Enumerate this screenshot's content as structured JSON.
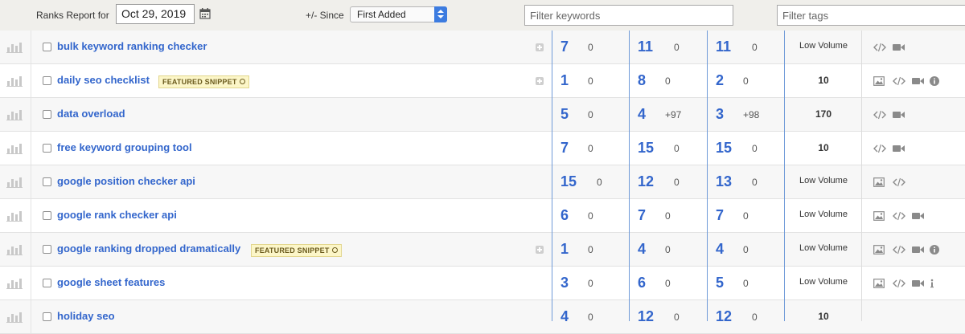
{
  "toolbar": {
    "report_label": "Ranks Report for",
    "date": "Oct 29, 2019",
    "since_label": "+/- Since",
    "since_selected": "First Added",
    "filter_keywords_placeholder": "Filter keywords",
    "filter_tags_placeholder": "Filter tags"
  },
  "colors": {
    "accent_blue": "#3366cc",
    "column_divider": "#6f9ad8",
    "featured_bg": "#fcf6c8"
  },
  "rows": [
    {
      "keyword": "bulk keyword ranking checker",
      "featured": "",
      "expand": true,
      "r1": "7",
      "c1": "0",
      "r2": "11",
      "c2": "0",
      "r3": "11",
      "c3": "0",
      "volume": "Low Volume",
      "icons": [
        "code-icon",
        "video-icon"
      ]
    },
    {
      "keyword": "daily seo checklist",
      "featured": "FEATURED SNIPPET",
      "expand": true,
      "r1": "1",
      "c1": "0",
      "r2": "8",
      "c2": "0",
      "r3": "2",
      "c3": "0",
      "volume": "10",
      "icons": [
        "image-icon",
        "code-icon",
        "video-icon",
        "info-icon"
      ]
    },
    {
      "keyword": "data overload",
      "featured": "",
      "expand": false,
      "r1": "5",
      "c1": "0",
      "r2": "4",
      "c2": "+97",
      "r3": "3",
      "c3": "+98",
      "volume": "170",
      "icons": [
        "code-icon",
        "video-icon"
      ]
    },
    {
      "keyword": "free keyword grouping tool",
      "featured": "",
      "expand": false,
      "r1": "7",
      "c1": "0",
      "r2": "15",
      "c2": "0",
      "r3": "15",
      "c3": "0",
      "volume": "10",
      "icons": [
        "code-icon",
        "video-icon"
      ]
    },
    {
      "keyword": "google position checker api",
      "featured": "",
      "expand": false,
      "r1": "15",
      "c1": "0",
      "r2": "12",
      "c2": "0",
      "r3": "13",
      "c3": "0",
      "volume": "Low Volume",
      "icons": [
        "image-icon",
        "code-icon"
      ]
    },
    {
      "keyword": "google rank checker api",
      "featured": "",
      "expand": false,
      "r1": "6",
      "c1": "0",
      "r2": "7",
      "c2": "0",
      "r3": "7",
      "c3": "0",
      "volume": "Low Volume",
      "icons": [
        "image-icon",
        "code-icon",
        "video-icon"
      ]
    },
    {
      "keyword": "google ranking dropped dramatically",
      "featured": "FEATURED SNIPPET",
      "expand": true,
      "r1": "1",
      "c1": "0",
      "r2": "4",
      "c2": "0",
      "r3": "4",
      "c3": "0",
      "volume": "Low Volume",
      "icons": [
        "image-icon",
        "code-icon",
        "video-icon",
        "info-icon"
      ]
    },
    {
      "keyword": "google sheet features",
      "featured": "",
      "expand": false,
      "r1": "3",
      "c1": "0",
      "r2": "6",
      "c2": "0",
      "r3": "5",
      "c3": "0",
      "volume": "Low Volume",
      "icons": [
        "image-icon",
        "code-icon",
        "video-icon",
        "info-small-icon"
      ]
    },
    {
      "keyword": "holiday seo",
      "featured": "",
      "expand": false,
      "r1": "4",
      "c1": "0",
      "r2": "12",
      "c2": "0",
      "r3": "12",
      "c3": "0",
      "volume": "10",
      "icons": []
    }
  ]
}
